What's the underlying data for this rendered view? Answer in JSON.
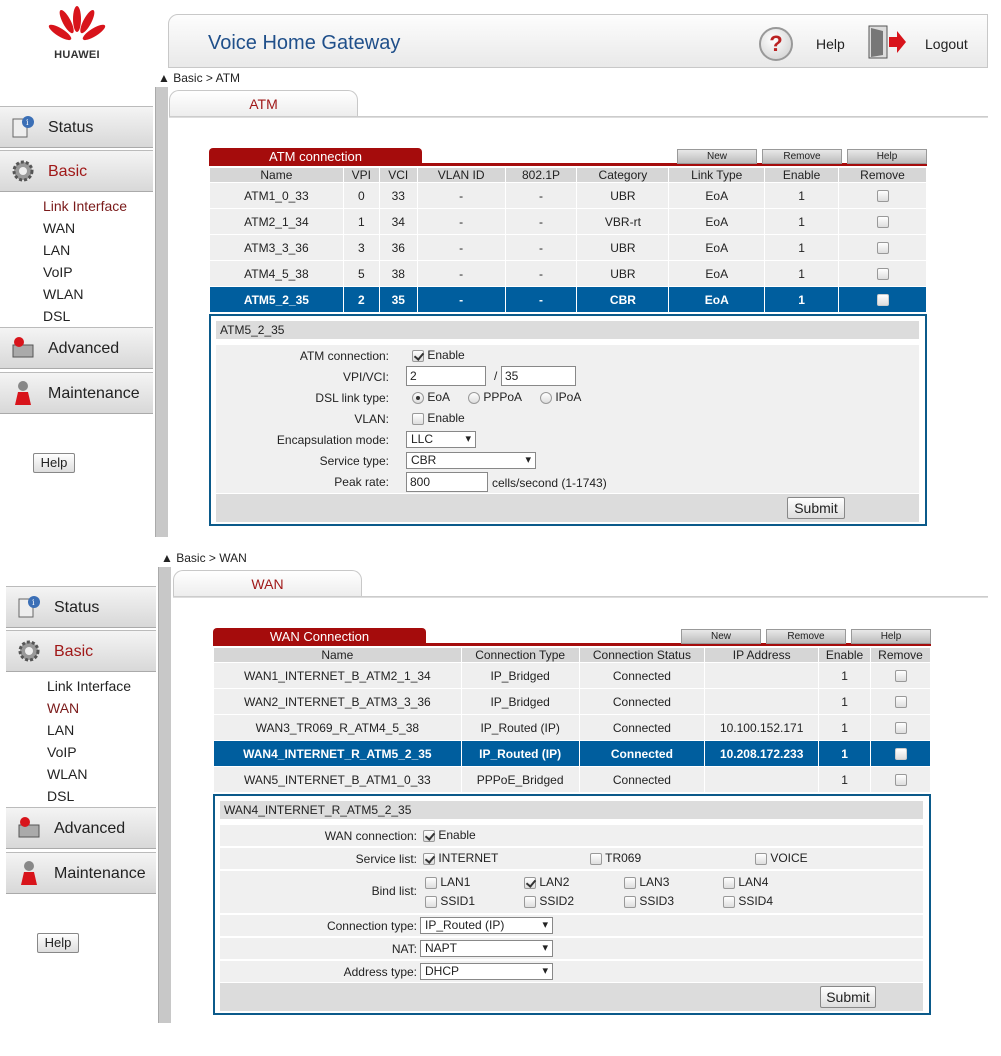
{
  "header": {
    "brand": "HUAWEI",
    "title": "Voice Home Gateway",
    "help": "Help",
    "logout": "Logout"
  },
  "sidebar": {
    "menu": {
      "status": "Status",
      "basic": "Basic",
      "advanced": "Advanced",
      "maintenance": "Maintenance"
    },
    "sub": [
      "Link Interface",
      "WAN",
      "LAN",
      "VoIP",
      "WLAN",
      "DSL"
    ],
    "help_button": "Help"
  },
  "atm": {
    "breadcrumb": "Basic > ATM",
    "tab": "ATM",
    "section_title": "ATM connection",
    "buttons": {
      "new": "New",
      "remove": "Remove",
      "help": "Help"
    },
    "columns": [
      "Name",
      "VPI",
      "VCI",
      "VLAN ID",
      "802.1P",
      "Category",
      "Link Type",
      "Enable",
      "Remove"
    ],
    "rows": [
      [
        "ATM1_0_33",
        "0",
        "33",
        "-",
        "-",
        "UBR",
        "EoA",
        "1"
      ],
      [
        "ATM2_1_34",
        "1",
        "34",
        "-",
        "-",
        "VBR-rt",
        "EoA",
        "1"
      ],
      [
        "ATM3_3_36",
        "3",
        "36",
        "-",
        "-",
        "UBR",
        "EoA",
        "1"
      ],
      [
        "ATM4_5_38",
        "5",
        "38",
        "-",
        "-",
        "UBR",
        "EoA",
        "1"
      ],
      [
        "ATM5_2_35",
        "2",
        "35",
        "-",
        "-",
        "CBR",
        "EoA",
        "1"
      ]
    ],
    "selected_row": 4,
    "detail": {
      "title": "ATM5_2_35",
      "atm_connection_label": "ATM connection:",
      "enable": "Enable",
      "vpivci_label": "VPI/VCI:",
      "vpi": "2",
      "slash": "/",
      "vci": "35",
      "dsl_link_label": "DSL link type:",
      "link_types": [
        "EoA",
        "PPPoA",
        "IPoA"
      ],
      "vlan_label": "VLAN:",
      "encap_label": "Encapsulation mode:",
      "encap": "LLC",
      "service_label": "Service type:",
      "service": "CBR",
      "peak_label": "Peak rate:",
      "peak": "800",
      "peak_unit": "cells/second (1-1743)",
      "submit": "Submit"
    }
  },
  "wan": {
    "breadcrumb": "Basic > WAN",
    "tab": "WAN",
    "section_title": "WAN Connection",
    "buttons": {
      "new": "New",
      "remove": "Remove",
      "help": "Help"
    },
    "columns": [
      "Name",
      "Connection Type",
      "Connection Status",
      "IP Address",
      "Enable",
      "Remove"
    ],
    "rows": [
      [
        "WAN1_INTERNET_B_ATM2_1_34",
        "IP_Bridged",
        "Connected",
        "",
        "1"
      ],
      [
        "WAN2_INTERNET_B_ATM3_3_36",
        "IP_Bridged",
        "Connected",
        "",
        "1"
      ],
      [
        "WAN3_TR069_R_ATM4_5_38",
        "IP_Routed (IP)",
        "Connected",
        "10.100.152.171",
        "1"
      ],
      [
        "WAN4_INTERNET_R_ATM5_2_35",
        "IP_Routed (IP)",
        "Connected",
        "10.208.172.233",
        "1"
      ],
      [
        "WAN5_INTERNET_B_ATM1_0_33",
        "PPPoE_Bridged",
        "Connected",
        "",
        "1"
      ]
    ],
    "selected_row": 3,
    "detail": {
      "title": "WAN4_INTERNET_R_ATM5_2_35",
      "wan_connection_label": "WAN connection:",
      "enable": "Enable",
      "service_label": "Service list:",
      "services": [
        "INTERNET",
        "TR069",
        "VOICE"
      ],
      "bind_label": "Bind list:",
      "bind": [
        "LAN1",
        "LAN2",
        "LAN3",
        "LAN4",
        "SSID1",
        "SSID2",
        "SSID3",
        "SSID4"
      ],
      "conn_type_label": "Connection type:",
      "conn_type": "IP_Routed (IP)",
      "nat_label": "NAT:",
      "nat": "NAPT",
      "addr_label": "Address type:",
      "addr": "DHCP",
      "submit": "Submit"
    }
  }
}
